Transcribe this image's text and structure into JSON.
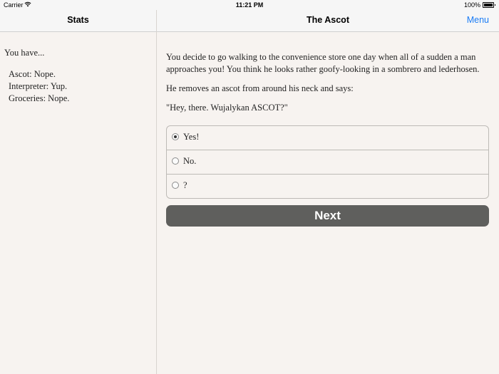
{
  "status_bar": {
    "carrier": "Carrier",
    "time": "11:21 PM",
    "battery": "100%",
    "battery_level": 1.0
  },
  "sidebar": {
    "title": "Stats",
    "heading": "You have...",
    "stats": [
      "Ascot: Nope.",
      "Interpreter: Yup.",
      "Groceries: Nope."
    ]
  },
  "main": {
    "title": "The Ascot",
    "menu_label": "Menu",
    "paragraphs": [
      "You decide to go walking to the convenience store one day when all of a sudden a man approaches you! You think he looks rather goofy-looking in a sombrero and lederhosen.",
      "He removes an ascot from around his neck and says:",
      "\"Hey, there. Wujalykan ASCOT?\""
    ],
    "choices": [
      {
        "label": "Yes!",
        "selected": true
      },
      {
        "label": "No.",
        "selected": false
      },
      {
        "label": "?",
        "selected": false
      }
    ],
    "next_label": "Next"
  },
  "colors": {
    "accent": "#1a7cf5",
    "background": "#f7f3f0",
    "button": "#5f5f5d"
  }
}
